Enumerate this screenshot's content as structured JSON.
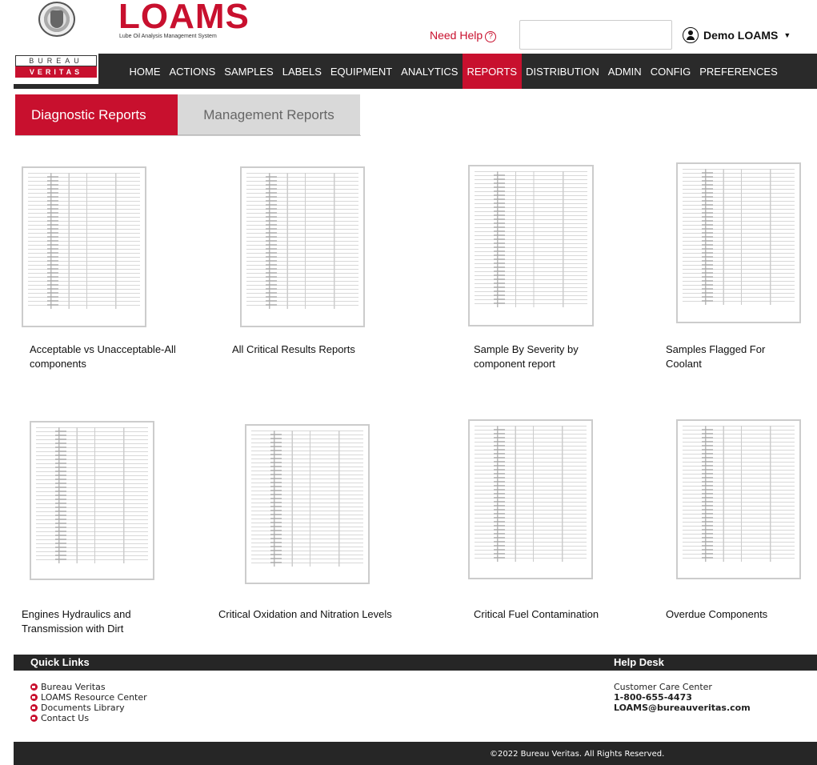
{
  "header": {
    "logo_text": "LOAMS",
    "logo_subtitle": "Lube Oil Analysis Management System",
    "need_help": "Need Help",
    "search_value": "",
    "user_name": "Demo LOAMS",
    "bv_top": "BUREAU",
    "bv_bottom": "VERITAS"
  },
  "nav": {
    "items": [
      "HOME",
      "ACTIONS",
      "SAMPLES",
      "LABELS",
      "EQUIPMENT",
      "ANALYTICS",
      "REPORTS",
      "DISTRIBUTION",
      "ADMIN",
      "CONFIG",
      "PREFERENCES"
    ],
    "active": "REPORTS"
  },
  "tabs": {
    "diagnostic": "Diagnostic Reports",
    "management": "Management Reports"
  },
  "reports": [
    {
      "label": "Acceptable vs Unacceptable-All components"
    },
    {
      "label": "All Critical Results Reports"
    },
    {
      "label": "Sample By Severity by component report"
    },
    {
      "label": "Samples Flagged For Coolant"
    },
    {
      "label": "Engines Hydraulics and Transmission with Dirt"
    },
    {
      "label": "Critical Oxidation and Nitration Levels"
    },
    {
      "label": "Critical Fuel Contamination"
    },
    {
      "label": "Overdue Components"
    }
  ],
  "footer": {
    "quick_links_title": "Quick Links",
    "quick_links": [
      "Bureau Veritas",
      "LOAMS Resource Center",
      "Documents Library",
      "Contact Us"
    ],
    "help_desk_title": "Help Desk",
    "help_desk_label": "Customer Care Center",
    "phone": "1-800-655-4473",
    "email": "LOAMS@bureauveritas.com",
    "copyright": "©2022 Bureau Veritas. All Rights Reserved."
  },
  "colors": {
    "brand_red": "#c8102e",
    "nav_bg": "#2a2a2a"
  }
}
